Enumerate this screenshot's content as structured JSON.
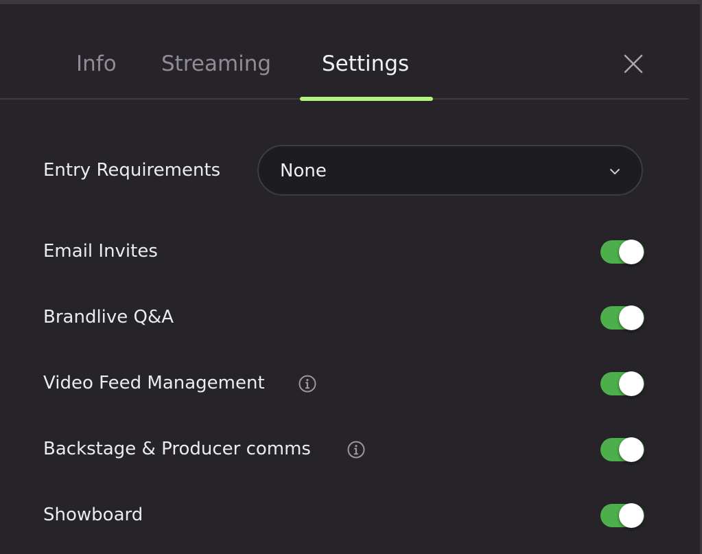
{
  "colors": {
    "accent": "#b5f27a",
    "toggle_on": "#4caf4c",
    "background": "#262429"
  },
  "tabs": [
    {
      "label": "Info",
      "active": false
    },
    {
      "label": "Streaming",
      "active": false
    },
    {
      "label": "Settings",
      "active": true
    }
  ],
  "close_icon": "close-icon",
  "entry_requirements": {
    "label": "Entry Requirements",
    "selected": "None",
    "icon": "chevron-down-icon"
  },
  "settings": [
    {
      "label": "Email Invites",
      "enabled": true,
      "info": false
    },
    {
      "label": "Brandlive Q&A",
      "enabled": true,
      "info": false
    },
    {
      "label": "Video Feed Management",
      "enabled": true,
      "info": true
    },
    {
      "label": "Backstage & Producer comms",
      "enabled": true,
      "info": true
    },
    {
      "label": "Showboard",
      "enabled": true,
      "info": false
    }
  ]
}
